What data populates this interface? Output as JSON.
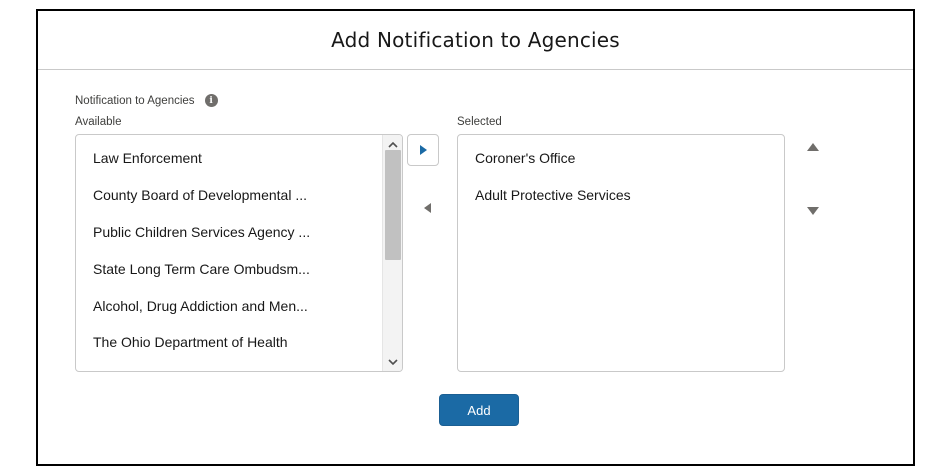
{
  "modal": {
    "title": "Add Notification to Agencies"
  },
  "field": {
    "label": "Notification to Agencies",
    "info_glyph": "i"
  },
  "available": {
    "label": "Available",
    "items": [
      "Law Enforcement",
      "County Board of Developmental ...",
      "Public Children Services Agency ...",
      "State Long Term Care Ombudsm...",
      "Alcohol, Drug Addiction and Men...",
      "The Ohio Department of Health"
    ]
  },
  "selected": {
    "label": "Selected",
    "items": [
      "Coroner's Office",
      "Adult Protective Services"
    ]
  },
  "actions": {
    "add_label": "Add"
  },
  "icons": {
    "move_right": "triangle-right-icon",
    "move_left": "triangle-left-icon",
    "move_up": "triangle-up-icon",
    "move_down": "triangle-down-icon",
    "info": "info-icon"
  },
  "colors": {
    "brand": "#1b6aa5",
    "move_right_icon": "#1b6aa5",
    "icon_gray": "#706e6b"
  }
}
